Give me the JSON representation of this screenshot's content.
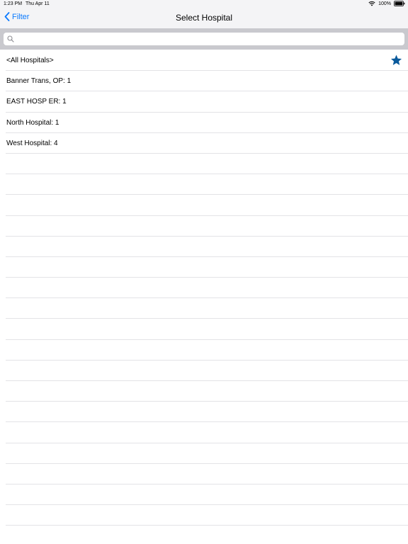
{
  "status_bar": {
    "time": "1:23 PM",
    "date": "Thu Apr 11",
    "battery": "100%",
    "icons": [
      "wifi-icon",
      "battery-icon"
    ]
  },
  "nav": {
    "back_label": "Filter",
    "title": "Select Hospital",
    "back_icon": "chevron-left-icon"
  },
  "search": {
    "placeholder": "",
    "value": "",
    "icon": "search-icon"
  },
  "list": {
    "items": [
      {
        "label": "<All Hospitals>",
        "favorite": true
      },
      {
        "label": "Banner Trans, OP: 1",
        "favorite": false
      },
      {
        "label": "EAST HOSP ER: 1",
        "favorite": false
      },
      {
        "label": "North Hospital: 1",
        "favorite": false
      },
      {
        "label": "West Hospital: 4",
        "favorite": false
      }
    ],
    "favorite_icon": "star-icon"
  },
  "colors": {
    "accent": "#0a7aff",
    "star": "#0a5a9c",
    "bar_bg": "#f4f4f6",
    "search_bg": "#c9c9ce",
    "separator": "#e3e3e6"
  }
}
